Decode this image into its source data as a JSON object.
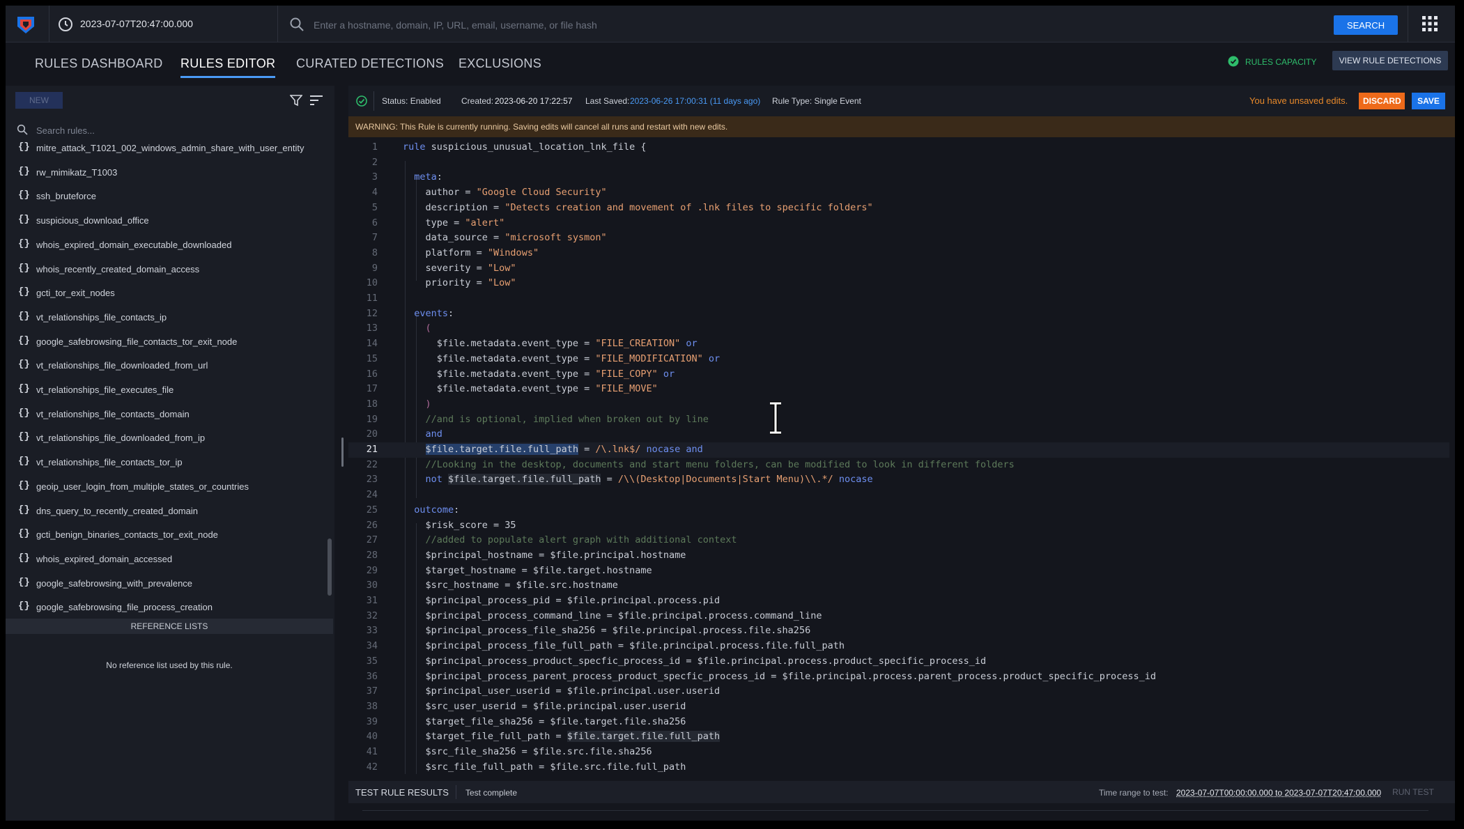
{
  "topbar": {
    "datetime": "2023-07-07T20:47:00.000",
    "search_placeholder": "Enter a hostname, domain, IP, URL, email, username, or file hash",
    "search_label": "SEARCH"
  },
  "nav": {
    "tabs": [
      {
        "label": "RULES DASHBOARD"
      },
      {
        "label": "RULES EDITOR"
      },
      {
        "label": "CURATED DETECTIONS"
      },
      {
        "label": "EXCLUSIONS"
      }
    ],
    "rules_capacity": "RULES CAPACITY",
    "view_detections": "VIEW RULE DETECTIONS"
  },
  "left": {
    "new_label": "NEW",
    "search_placeholder": "Search rules...",
    "rules": [
      "mitre_attack_T1021_002_windows_admin_share_with_user_entity",
      "rw_mimikatz_T1003",
      "ssh_bruteforce",
      "suspicious_download_office",
      "whois_expired_domain_executable_downloaded",
      "whois_recently_created_domain_access",
      "gcti_tor_exit_nodes",
      "vt_relationships_file_contacts_ip",
      "google_safebrowsing_file_contacts_tor_exit_node",
      "vt_relationships_file_downloaded_from_url",
      "vt_relationships_file_executes_file",
      "vt_relationships_file_contacts_domain",
      "vt_relationships_file_downloaded_from_ip",
      "vt_relationships_file_contacts_tor_ip",
      "geoip_user_login_from_multiple_states_or_countries",
      "dns_query_to_recently_created_domain",
      "gcti_benign_binaries_contacts_tor_exit_node",
      "whois_expired_domain_accessed",
      "google_safebrowsing_with_prevalence",
      "google_safebrowsing_file_process_creation"
    ],
    "reference_lists": "REFERENCE LISTS",
    "no_reference": "No reference list used by this rule."
  },
  "status": {
    "status": "Status: Enabled",
    "created_label": "Created: ",
    "created": "2023-06-20 17:22:57",
    "saved_label": "Last Saved: ",
    "saved": "2023-06-26 17:00:31 (11 days ago)",
    "rule_type": "Rule Type: Single Event",
    "unsaved": "You have unsaved edits.",
    "discard": "DISCARD",
    "save": "SAVE"
  },
  "warning": "WARNING: This Rule is currently running. Saving edits will cancel all runs and restart with new edits.",
  "code": {
    "current_line": 21,
    "lines": [
      [
        [
          "kw",
          "rule "
        ],
        [
          "id",
          "suspicious_unusual_location_lnk_file {"
        ]
      ],
      [],
      [
        [
          "id",
          "  "
        ],
        [
          "kw",
          "meta"
        ],
        [
          "id",
          ":"
        ]
      ],
      [
        [
          "id",
          "    author = "
        ],
        [
          "str",
          "\"Google Cloud Security\""
        ]
      ],
      [
        [
          "id",
          "    description = "
        ],
        [
          "str",
          "\"Detects creation and movement of .lnk files to specific folders\""
        ]
      ],
      [
        [
          "id",
          "    type = "
        ],
        [
          "str",
          "\"alert\""
        ]
      ],
      [
        [
          "id",
          "    data_source = "
        ],
        [
          "str",
          "\"microsoft sysmon\""
        ]
      ],
      [
        [
          "id",
          "    platform = "
        ],
        [
          "str",
          "\"Windows\""
        ]
      ],
      [
        [
          "id",
          "    severity = "
        ],
        [
          "str",
          "\"Low\""
        ]
      ],
      [
        [
          "id",
          "    priority = "
        ],
        [
          "str",
          "\"Low\""
        ]
      ],
      [],
      [
        [
          "id",
          "  "
        ],
        [
          "kw",
          "events"
        ],
        [
          "id",
          ":"
        ]
      ],
      [
        [
          "id",
          "    "
        ],
        [
          "pun",
          "("
        ]
      ],
      [
        [
          "id",
          "      $file.metadata.event_type = "
        ],
        [
          "str",
          "\"FILE_CREATION\""
        ],
        [
          "kw",
          " or"
        ]
      ],
      [
        [
          "id",
          "      $file.metadata.event_type = "
        ],
        [
          "str",
          "\"FILE_MODIFICATION\""
        ],
        [
          "kw",
          " or"
        ]
      ],
      [
        [
          "id",
          "      $file.metadata.event_type = "
        ],
        [
          "str",
          "\"FILE_COPY\""
        ],
        [
          "kw",
          " or"
        ]
      ],
      [
        [
          "id",
          "      $file.metadata.event_type = "
        ],
        [
          "str",
          "\"FILE_MOVE\""
        ]
      ],
      [
        [
          "id",
          "    "
        ],
        [
          "pun",
          ")"
        ]
      ],
      [
        [
          "id",
          "    "
        ],
        [
          "com",
          "//and is optional, implied when broken out by line"
        ]
      ],
      [
        [
          "id",
          "    "
        ],
        [
          "kw",
          "and"
        ]
      ],
      [
        [
          "id",
          "    "
        ],
        [
          "hl",
          "$file.target.file.full_path"
        ],
        [
          "id",
          " = "
        ],
        [
          "str",
          "/\\.lnk$/"
        ],
        [
          "kw",
          " nocase and"
        ]
      ],
      [
        [
          "id",
          "    "
        ],
        [
          "com",
          "//Looking in the desktop, documents and start menu folders, can be modified to look in different folders"
        ]
      ],
      [
        [
          "id",
          "    "
        ],
        [
          "kw",
          "not "
        ],
        [
          "hl2",
          "$file.target.file.full_path"
        ],
        [
          "id",
          " = "
        ],
        [
          "str",
          "/\\\\(Desktop|Documents|Start Menu)\\\\.*/"
        ],
        [
          "kw",
          " nocase"
        ]
      ],
      [],
      [
        [
          "id",
          "  "
        ],
        [
          "kw",
          "outcome"
        ],
        [
          "id",
          ":"
        ]
      ],
      [
        [
          "id",
          "    $risk_score = 35"
        ]
      ],
      [
        [
          "id",
          "    "
        ],
        [
          "com",
          "//added to populate alert graph with additional context"
        ]
      ],
      [
        [
          "id",
          "    $principal_hostname = $file.principal.hostname"
        ]
      ],
      [
        [
          "id",
          "    $target_hostname = $file.target.hostname"
        ]
      ],
      [
        [
          "id",
          "    $src_hostname = $file.src.hostname"
        ]
      ],
      [
        [
          "id",
          "    $principal_process_pid = $file.principal.process.pid"
        ]
      ],
      [
        [
          "id",
          "    $principal_process_command_line = $file.principal.process.command_line"
        ]
      ],
      [
        [
          "id",
          "    $principal_process_file_sha256 = $file.principal.process.file.sha256"
        ]
      ],
      [
        [
          "id",
          "    $principal_process_file_full_path = $file.principal.process.file.full_path"
        ]
      ],
      [
        [
          "id",
          "    $principal_process_product_specfic_process_id = $file.principal.process.product_specific_process_id"
        ]
      ],
      [
        [
          "id",
          "    $principal_process_parent_process_product_specfic_process_id = $file.principal.process.parent_process.product_specific_process_id"
        ]
      ],
      [
        [
          "id",
          "    $principal_user_userid = $file.principal.user.userid"
        ]
      ],
      [
        [
          "id",
          "    $src_user_userid = $file.principal.user.userid"
        ]
      ],
      [
        [
          "id",
          "    $target_file_sha256 = $file.target.file.sha256"
        ]
      ],
      [
        [
          "id",
          "    $target_file_full_path = "
        ],
        [
          "hl2",
          "$file.target.file.full_path"
        ]
      ],
      [
        [
          "id",
          "    $src_file_sha256 = $file.src.file.sha256"
        ]
      ],
      [
        [
          "id",
          "    $src_file_full_path = $file.src.file.full_path"
        ]
      ]
    ]
  },
  "bottom": {
    "results": "TEST RULE RESULTS",
    "complete": "Test complete",
    "range_label": "Time range to test: ",
    "range": "2023-07-07T00:00:00.000 to 2023-07-07T20:47:00.000",
    "run_test": "RUN TEST"
  },
  "colors": {
    "keyword": "#6e8ff0",
    "string": "#e8a072",
    "comment": "#5d7a5a",
    "identifier": "#c9cdd6",
    "accent": "#1a73e8",
    "warning": "#ee6a1a"
  }
}
